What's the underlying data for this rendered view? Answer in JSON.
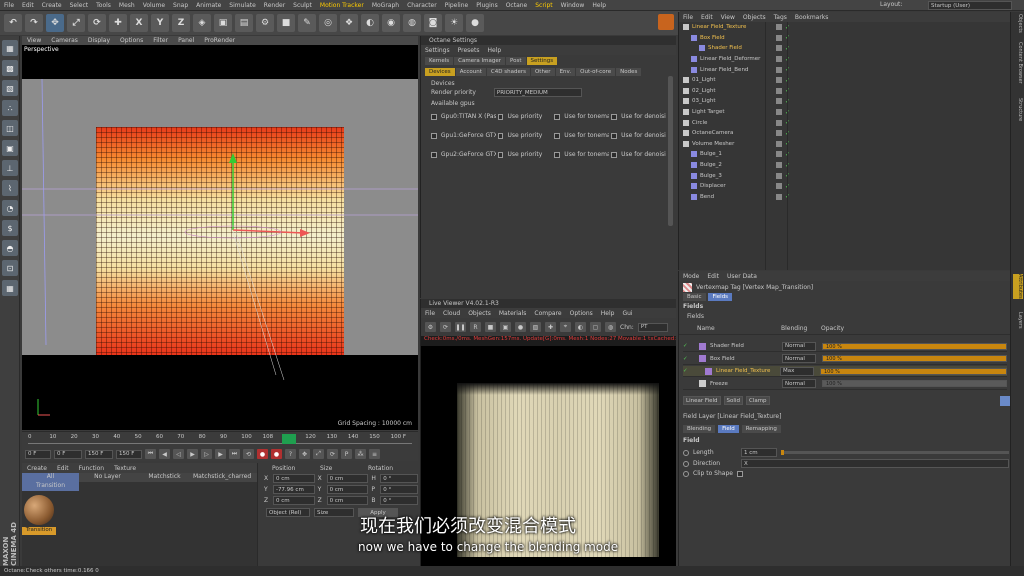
{
  "menu": {
    "items": [
      "File",
      "Edit",
      "Create",
      "Select",
      "Tools",
      "Mesh",
      "Volume",
      "Snap",
      "Animate",
      "Simulate",
      "Render",
      "Sculpt",
      "Motion Tracker",
      "MoGraph",
      "Character",
      "Pipeline",
      "Plugins",
      "Octane",
      "Script",
      "Window",
      "Help"
    ],
    "layout_label": "Layout:",
    "layout_value": "Startup (User)"
  },
  "toolbar": {
    "axes": [
      "X",
      "Y",
      "Z"
    ]
  },
  "viewport": {
    "menu": [
      "View",
      "Cameras",
      "Display",
      "Options",
      "Filter",
      "Panel",
      "ProRender"
    ],
    "label": "Perspective",
    "grid_spacing": "Grid Spacing : 10000 cm"
  },
  "timeline": {
    "ticks": [
      "0",
      "10",
      "20",
      "30",
      "40",
      "50",
      "60",
      "70",
      "80",
      "90",
      "100",
      "108",
      "110",
      "120",
      "130",
      "140",
      "150",
      "100 F"
    ],
    "start": "0 F",
    "start2": "0 F",
    "end": "150 F",
    "end2": "150 F"
  },
  "material": {
    "menu": [
      "Create",
      "Edit",
      "Function",
      "Texture"
    ],
    "cols": [
      "All",
      "No Layer",
      "Matchstick",
      "Matchstick_charred"
    ],
    "row1": "Transition",
    "swatch_label": "Transition"
  },
  "coordinates": {
    "headers": [
      "Position",
      "Size",
      "Rotation"
    ],
    "rows": [
      {
        "axis": "X",
        "pos": "0 cm",
        "size": "0 cm",
        "rotaxis": "H",
        "rot": "0 °"
      },
      {
        "axis": "Y",
        "pos": "-77.96 cm",
        "size": "0 cm",
        "rotaxis": "P",
        "rot": "0 °"
      },
      {
        "axis": "Z",
        "pos": "0 cm",
        "size": "0 cm",
        "rotaxis": "B",
        "rot": "0 °"
      }
    ],
    "mode1": "Object (Rel)",
    "mode2": "Size",
    "apply": "Apply"
  },
  "octane_settings": {
    "title": "Octane Settings",
    "menu": [
      "Settings",
      "Presets",
      "Help"
    ],
    "tabs": [
      "Kernels",
      "Camera Imager",
      "Post",
      "Settings"
    ],
    "subtabs": [
      "Devices",
      "Account",
      "C4D shaders",
      "Other",
      "Env.",
      "Out-of-core",
      "Nodes"
    ],
    "devices_label": "Devices",
    "render_priority_label": "Render priority",
    "render_priority_value": "PRIORITY_MEDIUM",
    "gpus_label": "Available gpus",
    "gpus": [
      {
        "name": "Gpu0:TITAN X (Pascal",
        "p1": "Use priority",
        "p2": "Use for tonemap",
        "p3": "Use for denoising"
      },
      {
        "name": "Gpu1:GeForce GTX 1",
        "p1": "Use priority",
        "p2": "Use for tonemap",
        "p3": "Use for denoising"
      },
      {
        "name": "Gpu2:GeForce GTX 1",
        "p1": "Use priority",
        "p2": "Use for tonemap",
        "p3": "Use for denoising"
      }
    ]
  },
  "live_viewer": {
    "title": "Live Viewer V4.02.1-R3",
    "menu": [
      "File",
      "Cloud",
      "Objects",
      "Materials",
      "Compare",
      "Options",
      "Help",
      "Gui"
    ],
    "chn": "Chn:",
    "chn_value": "PT",
    "status": "Check:0ms./0ms. MeshGen:157ms. Update[G]:0ms. Mesh:1 Nodes:27 Movable:1 txCached:0"
  },
  "objects": {
    "menu": [
      "File",
      "Edit",
      "View",
      "Objects",
      "Tags",
      "Bookmarks"
    ],
    "items": [
      {
        "name": "Linear Field_Texture",
        "indent": 0,
        "color": "#f2c14e"
      },
      {
        "name": "Box Field",
        "indent": 1,
        "color": "#f2c14e"
      },
      {
        "name": "Shader Field",
        "indent": 2,
        "color": "#f2c14e"
      },
      {
        "name": "Linear Field_Deformer",
        "indent": 1,
        "color": "#c8c8c8"
      },
      {
        "name": "Linear Field_Bend",
        "indent": 1,
        "color": "#c8c8c8"
      },
      {
        "name": "01_Light",
        "indent": 0,
        "color": "#c8c8c8"
      },
      {
        "name": "02_Light",
        "indent": 0,
        "color": "#c8c8c8"
      },
      {
        "name": "03_Light",
        "indent": 0,
        "color": "#c8c8c8"
      },
      {
        "name": "Light Target",
        "indent": 0,
        "color": "#c8c8c8"
      },
      {
        "name": "Circle",
        "indent": 0,
        "color": "#c8c8c8"
      },
      {
        "name": "OctaneCamera",
        "indent": 0,
        "color": "#c8c8c8"
      },
      {
        "name": "Volume Mesher",
        "indent": 0,
        "color": "#c8c8c8"
      },
      {
        "name": "Bulge_1",
        "indent": 1,
        "color": "#c8c8c8"
      },
      {
        "name": "Bulge_2",
        "indent": 1,
        "color": "#c8c8c8"
      },
      {
        "name": "Bulge_3",
        "indent": 1,
        "color": "#c8c8c8"
      },
      {
        "name": "Displacer",
        "indent": 1,
        "color": "#c8c8c8"
      },
      {
        "name": "Bend",
        "indent": 1,
        "color": "#c8c8c8"
      }
    ]
  },
  "attributes": {
    "menu": [
      "Mode",
      "Edit",
      "User Data"
    ],
    "tag_title": "Vertexmap Tag [Vertex Map_Transition]",
    "tabs": [
      "Basic",
      "Fields"
    ],
    "section": "Fields",
    "fields_label": "Fields",
    "cols": [
      "Name",
      "Blending",
      "Opacity"
    ],
    "rows": [
      {
        "name": "Shader Field",
        "blend": "Normal",
        "opacity": "100 %",
        "opacity_frac": 1.0
      },
      {
        "name": "Box Field",
        "blend": "Normal",
        "opacity": "100 %",
        "opacity_frac": 1.0
      },
      {
        "name": "Linear Field_Texture",
        "blend": "Max",
        "opacity": "100 %",
        "opacity_frac": 1.0
      },
      {
        "name": "Freeze",
        "blend": "Normal",
        "opacity": "100 %",
        "opacity_frac": 1.0
      }
    ],
    "buttons": [
      "Linear Field",
      "Solid",
      "Clamp"
    ],
    "layer_title": "Field Layer [Linear Field_Texture]",
    "sub_tabs": [
      "Blending",
      "Field",
      "Remapping"
    ],
    "field_section": "Field",
    "length_label": "Length",
    "length_value": "1 cm",
    "direction_label": "Direction",
    "direction_value": "X",
    "clip_label": "Clip to Shape"
  },
  "right_tabs": [
    "Objects",
    "Content Browser",
    "Structure",
    "Attributes",
    "Layers"
  ],
  "status_bar": "Octane:Check others time:0.166  0",
  "subtitle_cn": "现在我们必须改变混合模式",
  "subtitle_en": "now we have to change the blending mode",
  "brand": "MAXON CINEMA 4D"
}
